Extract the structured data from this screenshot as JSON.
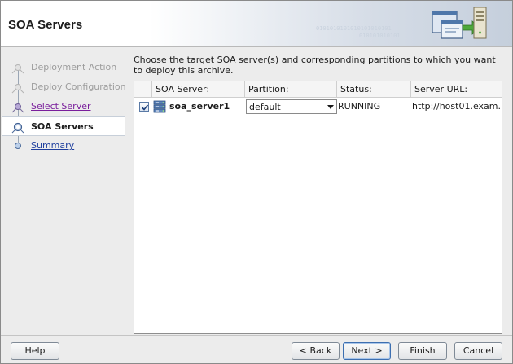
{
  "header": {
    "title": "SOA Servers",
    "binary_text": [
      "0101010101010101010101",
      "010101010101"
    ]
  },
  "nav": {
    "items": [
      {
        "label": "Deployment Action",
        "state": "disabled"
      },
      {
        "label": "Deploy Configuration",
        "state": "disabled"
      },
      {
        "label": "Select Server",
        "state": "visited"
      },
      {
        "label": "SOA Servers",
        "state": "current"
      },
      {
        "label": "Summary",
        "state": "link"
      }
    ]
  },
  "main": {
    "instructions": "Choose the target SOA server(s) and corresponding partitions to which you want to deploy this archive.",
    "table": {
      "columns": [
        "SOA Server:",
        "Partition:",
        "Status:",
        "Server URL:"
      ],
      "rows": [
        {
          "checked": true,
          "server": "soa_server1",
          "partition": "default",
          "status": "RUNNING",
          "url": "http://host01.exam..."
        }
      ]
    }
  },
  "footer": {
    "help": "Help",
    "back": "< Back",
    "next": "Next >",
    "finish": "Finish",
    "cancel": "Cancel"
  },
  "colors": {
    "link": "#1f3f9e",
    "visited": "#7a1f9c",
    "disabled": "#9d9d9d",
    "accent": "#3d6fb0"
  },
  "icons": [
    "wizard-header-icon",
    "train-stop-icon",
    "checkbox-check-icon",
    "soa-server-icon",
    "dropdown-arrow-icon"
  ]
}
